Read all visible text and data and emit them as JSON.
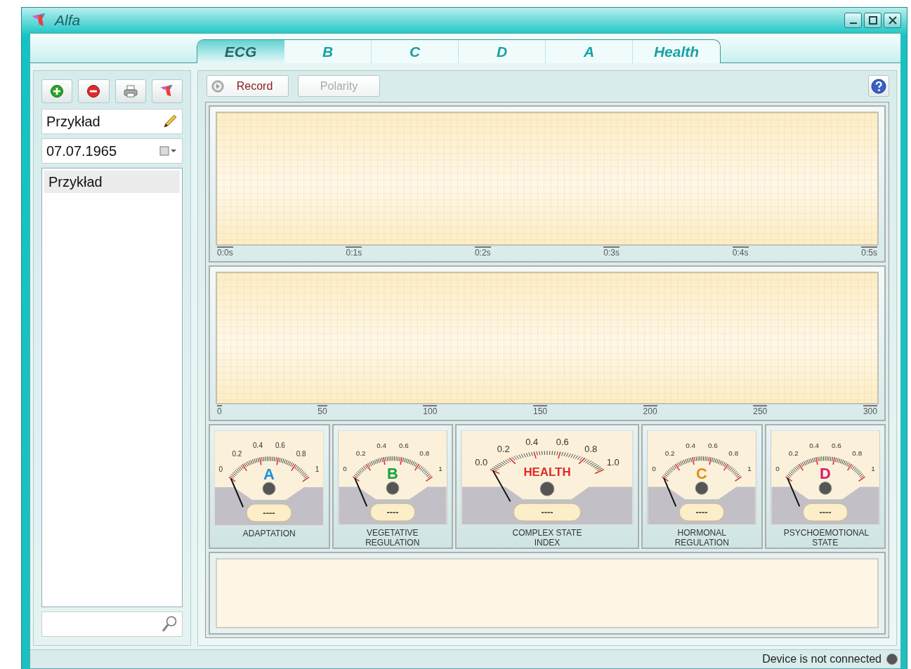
{
  "window": {
    "title": "Alfa"
  },
  "tabs": [
    {
      "label": "ECG",
      "selected": true
    },
    {
      "label": "B",
      "selected": false
    },
    {
      "label": "C",
      "selected": false
    },
    {
      "label": "D",
      "selected": false
    },
    {
      "label": "A",
      "selected": false
    },
    {
      "label": "Health",
      "selected": false
    }
  ],
  "sidebar": {
    "name_field": {
      "value": "Przykład"
    },
    "date_field": {
      "value": "07.07.1965"
    },
    "list": [
      {
        "label": "Przykład",
        "selected": true
      }
    ]
  },
  "toolbar": {
    "record": {
      "label": "Record",
      "disabled": false
    },
    "polarity": {
      "label": "Polarity",
      "disabled": true
    }
  },
  "graphs": [
    {
      "axis_labels": [
        "0:0s",
        "0:1s",
        "0:2s",
        "0:3s",
        "0:4s",
        "0:5s"
      ]
    },
    {
      "axis_labels": [
        "0",
        "50",
        "100",
        "150",
        "200",
        "250",
        "300"
      ]
    }
  ],
  "gauges": [
    {
      "kind": "small",
      "letter": "A",
      "color": "#1e90d8",
      "scale": [
        "0",
        "0.2",
        "0.4",
        "0.6",
        "0.8",
        "1"
      ],
      "readout": "----",
      "caption": "ADAPTATION"
    },
    {
      "kind": "small",
      "letter": "B",
      "color": "#1aa040",
      "scale": [
        "0",
        "0.2",
        "0.4",
        "0.6",
        "0.8",
        "1"
      ],
      "readout": "----",
      "caption": "VEGETATIVE REGULATION"
    },
    {
      "kind": "large",
      "letter": "HEALTH",
      "color": "#e02828",
      "scale": [
        "0.0",
        "0.2",
        "0.4",
        "0.6",
        "0.8",
        "1.0"
      ],
      "readout": "----",
      "caption": "COMPLEX STATE INDEX"
    },
    {
      "kind": "small",
      "letter": "C",
      "color": "#e88a10",
      "scale": [
        "0",
        "0.2",
        "0.4",
        "0.6",
        "0.8",
        "1"
      ],
      "readout": "----",
      "caption": "HORMONAL REGULATION"
    },
    {
      "kind": "small",
      "letter": "D",
      "color": "#d81870",
      "scale": [
        "0",
        "0.2",
        "0.4",
        "0.6",
        "0.8",
        "1"
      ],
      "readout": "----",
      "caption": "PSYCHOEMOTIONAL STATE"
    }
  ],
  "status_bar": {
    "text": "Device is not connected",
    "connected": false
  }
}
